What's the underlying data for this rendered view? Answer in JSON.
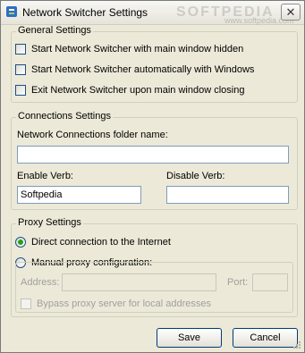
{
  "window": {
    "title": "Network Switcher Settings",
    "watermark": "SOFTPEDIA",
    "watermark_url": "www.softpedia.com",
    "close_glyph": "✕"
  },
  "general": {
    "legend": "General Settings",
    "options": [
      {
        "label": "Start Network Switcher with main window hidden",
        "checked": false
      },
      {
        "label": "Start Network Switcher automatically with Windows",
        "checked": false
      },
      {
        "label": "Exit Network Switcher upon main window closing",
        "checked": false
      }
    ]
  },
  "connections": {
    "legend": "Connections Settings",
    "folder_label": "Network Connections folder name:",
    "folder_value": "",
    "enable_label": "Enable Verb:",
    "enable_value": "Softpedia",
    "disable_label": "Disable Verb:",
    "disable_value": ""
  },
  "proxy": {
    "legend": "Proxy Settings",
    "direct_label": "Direct connection to the Internet",
    "manual_label": "Manual proxy configuration:",
    "selected": "direct",
    "address_label": "Address:",
    "address_value": "",
    "port_label": "Port:",
    "port_value": "",
    "bypass_label": "Bypass proxy server for local addresses",
    "bypass_checked": false
  },
  "buttons": {
    "save": "Save",
    "cancel": "Cancel"
  },
  "colors": {
    "face": "#ece9d8",
    "radio_dot": "#21a121",
    "disabled_text": "#a0a0a0"
  },
  "icons": {
    "app": "network-switcher-app-icon",
    "close": "close-icon",
    "grip": "resize-grip-icon"
  }
}
